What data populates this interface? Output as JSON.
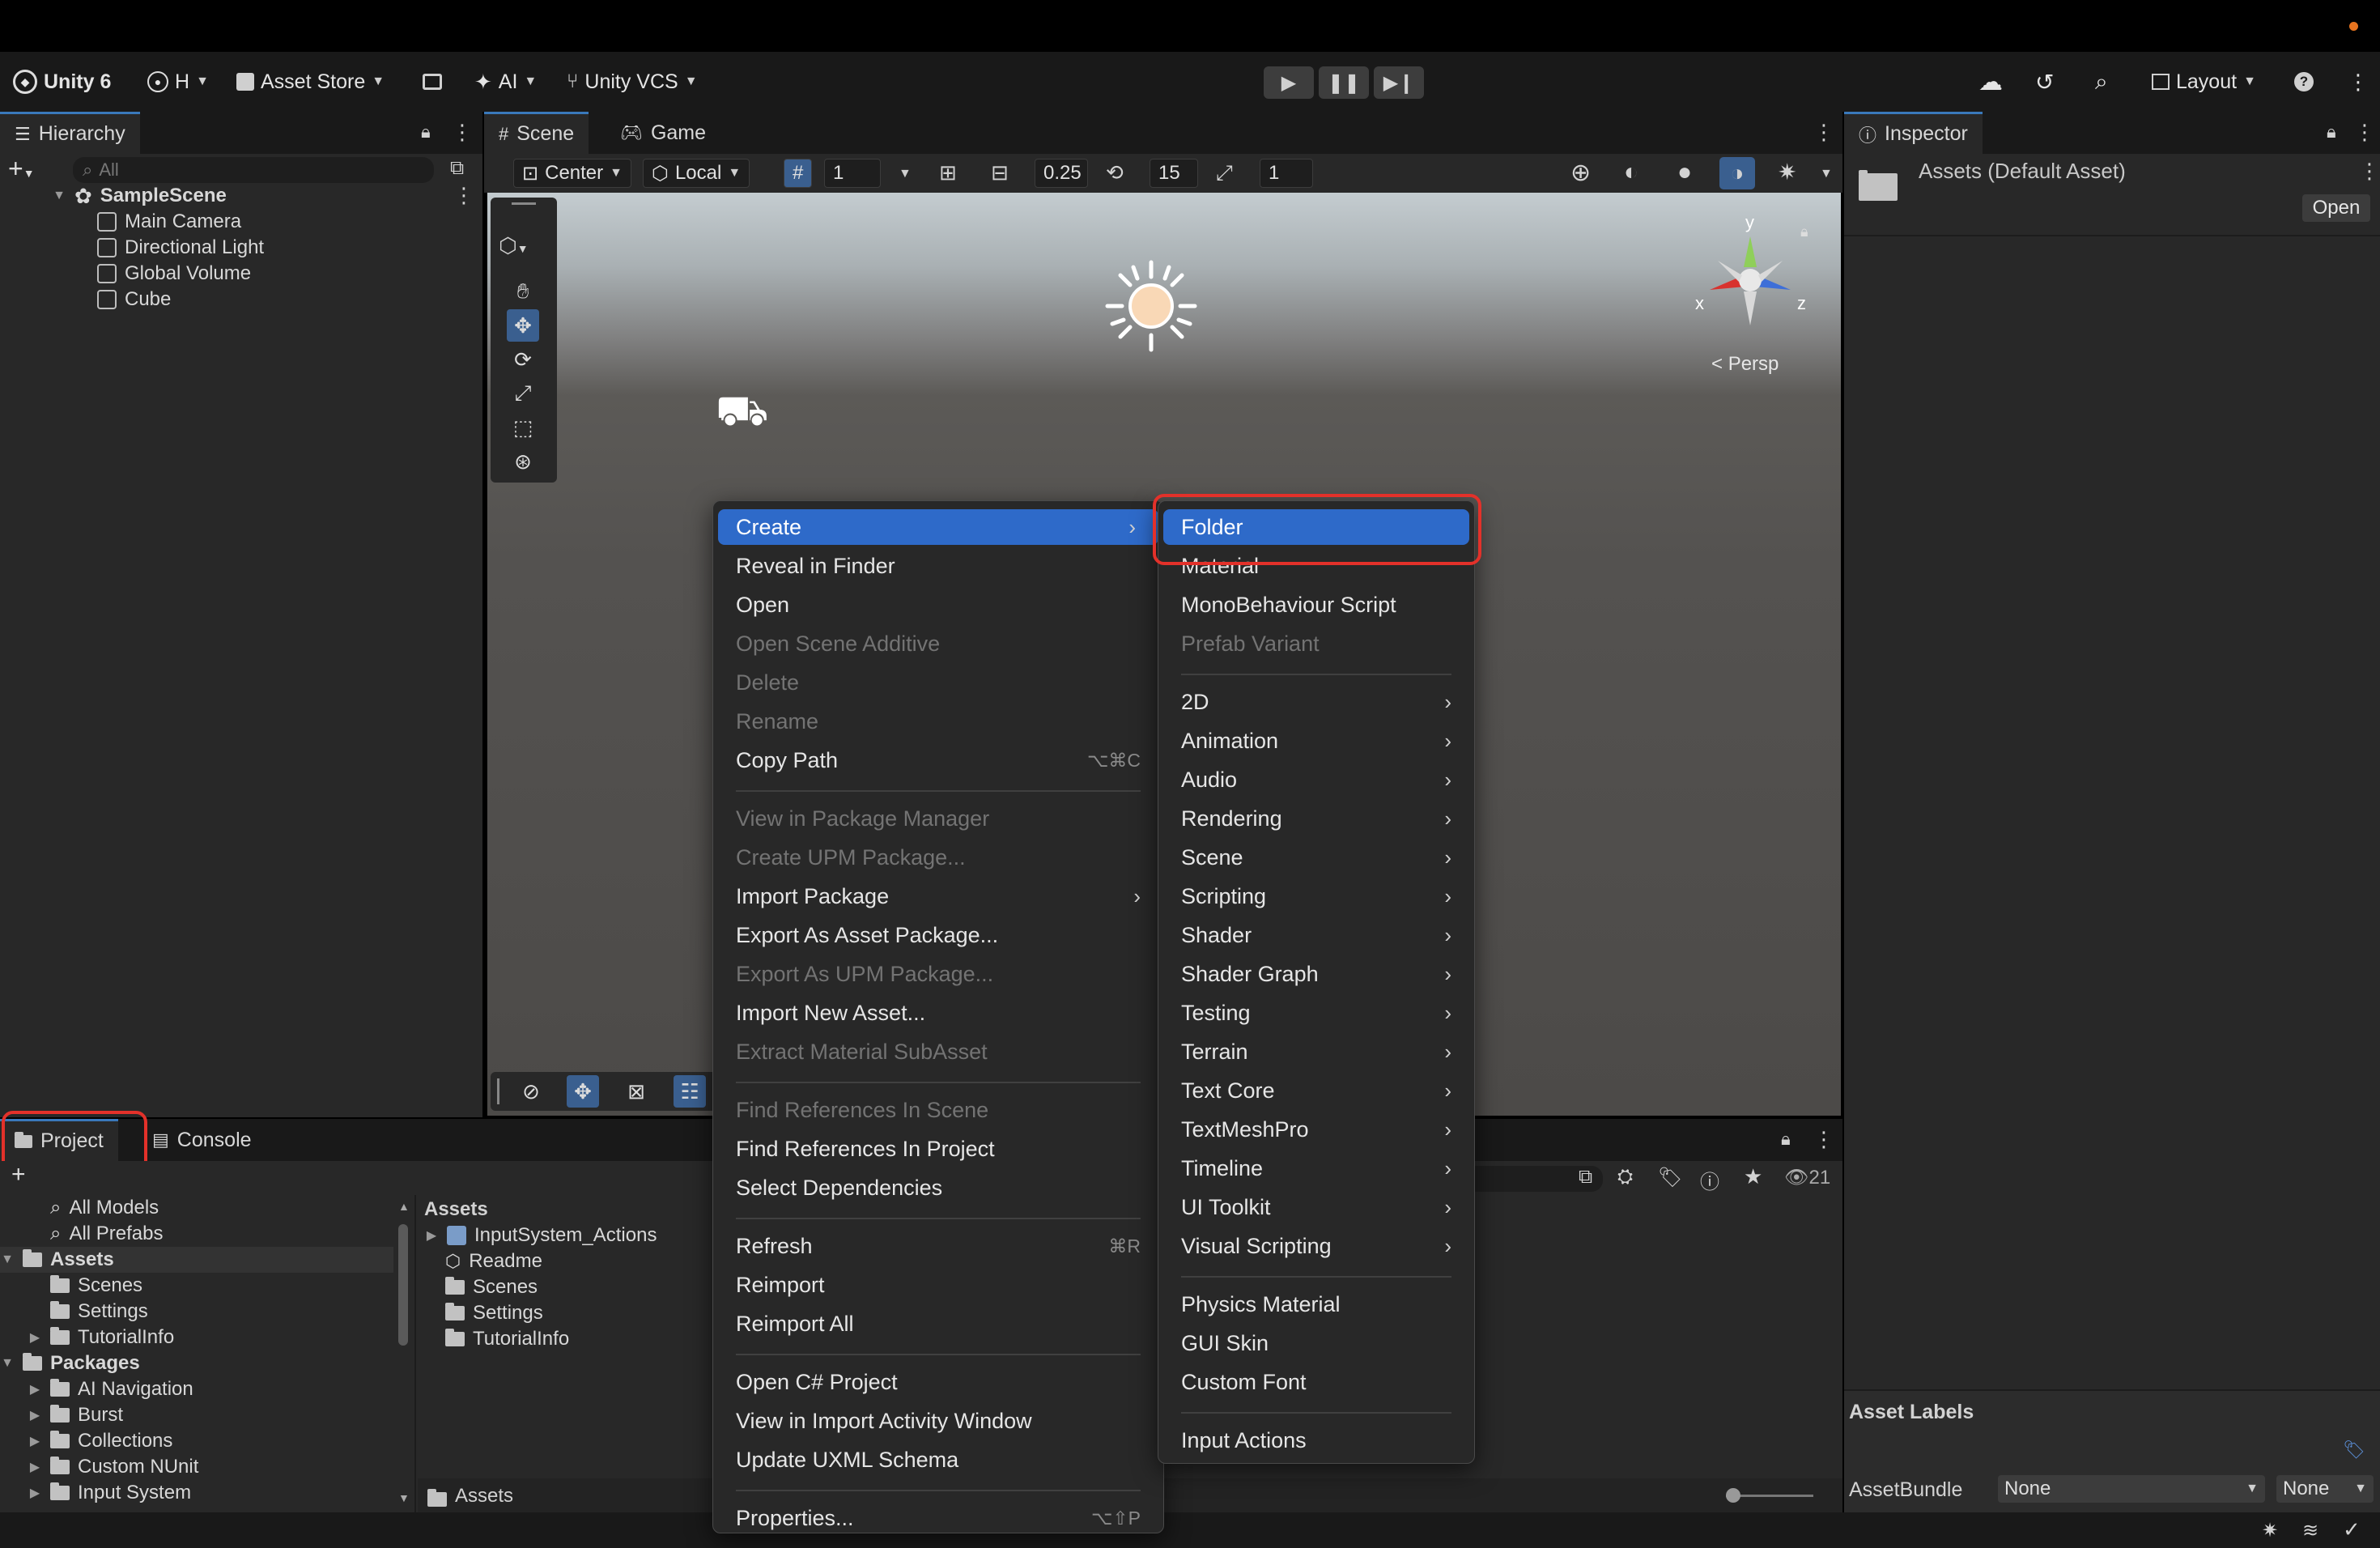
{
  "topbar": {
    "unity_label": "Unity 6",
    "account_label": "H",
    "asset_store_label": "Asset Store",
    "ai_label": "AI",
    "vcs_label": "Unity VCS",
    "layout_label": "Layout"
  },
  "hierarchy": {
    "tab_label": "Hierarchy",
    "search_placeholder": "All",
    "scene_name": "SampleScene",
    "items": [
      "Main Camera",
      "Directional Light",
      "Global Volume",
      "Cube"
    ]
  },
  "scene": {
    "tabs": [
      "Scene",
      "Game"
    ],
    "pivot_label": "Center",
    "space_label": "Local",
    "grid_value": "1",
    "snap_value": "0.25",
    "angle_value": "15",
    "scale_value": "1",
    "persp_label": "Persp",
    "gizmo_axes": {
      "y": "y",
      "x": "x",
      "z": "z"
    }
  },
  "inspector": {
    "tab_label": "Inspector",
    "asset_title": "Assets (Default Asset)",
    "open_button": "Open",
    "asset_labels_heading": "Asset Labels",
    "assetbundle_label": "AssetBundle",
    "assetbundle_value": "None",
    "variant_value": "None"
  },
  "project": {
    "tabs": [
      "Project",
      "Console"
    ],
    "favorites": [
      "All Models",
      "All Prefabs"
    ],
    "tree": [
      {
        "label": "Assets",
        "level": 0,
        "bold": true,
        "expanded": true
      },
      {
        "label": "Scenes",
        "level": 1
      },
      {
        "label": "Settings",
        "level": 1
      },
      {
        "label": "TutorialInfo",
        "level": 1,
        "collapsed": true
      },
      {
        "label": "Packages",
        "level": 0,
        "bold": true,
        "expanded": true
      },
      {
        "label": "AI Navigation",
        "level": 1,
        "collapsed": true
      },
      {
        "label": "Burst",
        "level": 1,
        "collapsed": true
      },
      {
        "label": "Collections",
        "level": 1,
        "collapsed": true
      },
      {
        "label": "Custom NUnit",
        "level": 1,
        "collapsed": true
      },
      {
        "label": "Input System",
        "level": 1,
        "collapsed": true
      }
    ],
    "assets_heading": "Assets",
    "assets": [
      "InputSystem_Actions",
      "Readme",
      "Scenes",
      "Settings",
      "TutorialInfo"
    ],
    "breadcrumb": "Assets",
    "count_label": "21"
  },
  "context_menu": {
    "items": [
      {
        "label": "Create",
        "submenu": true,
        "highlight": true
      },
      {
        "label": "Reveal in Finder"
      },
      {
        "label": "Open"
      },
      {
        "label": "Open Scene Additive",
        "disabled": true
      },
      {
        "label": "Delete",
        "disabled": true
      },
      {
        "label": "Rename",
        "disabled": true
      },
      {
        "label": "Copy Path",
        "shortcut": "⌥⌘C"
      },
      {
        "sep": true
      },
      {
        "label": "View in Package Manager",
        "disabled": true
      },
      {
        "label": "Create UPM Package...",
        "disabled": true
      },
      {
        "label": "Import Package",
        "submenu": true
      },
      {
        "label": "Export As Asset Package..."
      },
      {
        "label": "Export As UPM Package...",
        "disabled": true
      },
      {
        "label": "Import New Asset..."
      },
      {
        "label": "Extract Material SubAsset",
        "disabled": true
      },
      {
        "sep": true
      },
      {
        "label": "Find References In Scene",
        "disabled": true
      },
      {
        "label": "Find References In Project"
      },
      {
        "label": "Select Dependencies"
      },
      {
        "sep": true
      },
      {
        "label": "Refresh",
        "shortcut": "⌘R"
      },
      {
        "label": "Reimport"
      },
      {
        "label": "Reimport All"
      },
      {
        "sep": true
      },
      {
        "label": "Open C# Project"
      },
      {
        "label": "View in Import Activity Window"
      },
      {
        "label": "Update UXML Schema"
      },
      {
        "sep": true
      },
      {
        "label": "Properties...",
        "shortcut": "⌥⇧P"
      }
    ]
  },
  "create_submenu": {
    "items": [
      {
        "label": "Folder",
        "highlight": true
      },
      {
        "label": "Material"
      },
      {
        "label": "MonoBehaviour Script"
      },
      {
        "label": "Prefab Variant",
        "disabled": true
      },
      {
        "sep": true
      },
      {
        "label": "2D",
        "submenu": true
      },
      {
        "label": "Animation",
        "submenu": true
      },
      {
        "label": "Audio",
        "submenu": true
      },
      {
        "label": "Rendering",
        "submenu": true
      },
      {
        "label": "Scene",
        "submenu": true
      },
      {
        "label": "Scripting",
        "submenu": true
      },
      {
        "label": "Shader",
        "submenu": true
      },
      {
        "label": "Shader Graph",
        "submenu": true
      },
      {
        "label": "Testing",
        "submenu": true
      },
      {
        "label": "Terrain",
        "submenu": true
      },
      {
        "label": "Text Core",
        "submenu": true
      },
      {
        "label": "TextMeshPro",
        "submenu": true
      },
      {
        "label": "Timeline",
        "submenu": true
      },
      {
        "label": "UI Toolkit",
        "submenu": true
      },
      {
        "label": "Visual Scripting",
        "submenu": true
      },
      {
        "sep": true
      },
      {
        "label": "Physics Material"
      },
      {
        "label": "GUI Skin"
      },
      {
        "label": "Custom Font"
      },
      {
        "sep": true
      },
      {
        "label": "Input Actions"
      }
    ]
  },
  "colors": {
    "accent": "#2e6ac9",
    "annotation": "#e3312a",
    "recording_dot": "#e8741f"
  }
}
